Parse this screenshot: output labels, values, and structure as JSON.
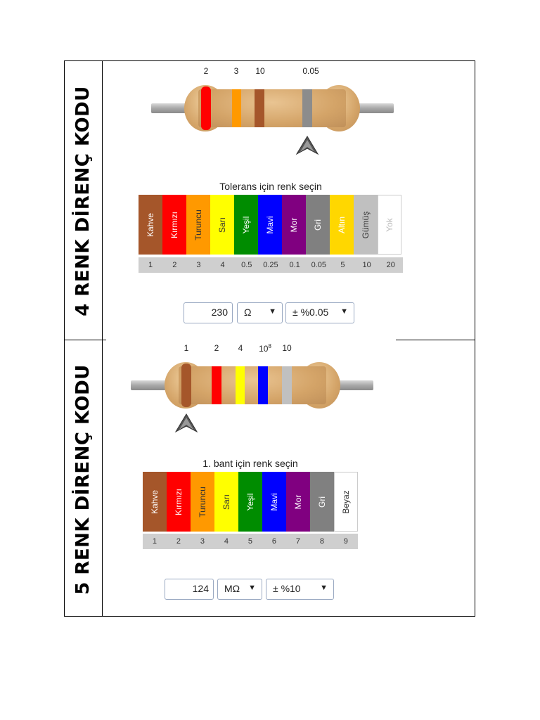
{
  "section4": {
    "title": "4 RENK DİRENÇ KODU",
    "band_labels": [
      "2",
      "3",
      "10",
      "0.05"
    ],
    "band_colors": [
      "#ff0000",
      "#ff9900",
      "#a5562a",
      "#8c8c8c"
    ],
    "picker_title": "Tolerans için renk seçin",
    "swatches": [
      {
        "label": "Kahve",
        "color": "#a5562a",
        "text_color": "#ffffff",
        "value": "1"
      },
      {
        "label": "Kırmızı",
        "color": "#ff0000",
        "text_color": "#ffffff",
        "value": "2"
      },
      {
        "label": "Turuncu",
        "color": "#ff9900",
        "text_color": "#333333",
        "value": "3"
      },
      {
        "label": "Sarı",
        "color": "#ffff00",
        "text_color": "#333333",
        "value": "4"
      },
      {
        "label": "Yeşil",
        "color": "#008c00",
        "text_color": "#ffffff",
        "value": "0.5"
      },
      {
        "label": "Mavi",
        "color": "#0000ff",
        "text_color": "#ffffff",
        "value": "0.25"
      },
      {
        "label": "Mor",
        "color": "#800080",
        "text_color": "#ffffff",
        "value": "0.1"
      },
      {
        "label": "Gri",
        "color": "#808080",
        "text_color": "#ffffff",
        "value": "0.05"
      },
      {
        "label": "Altın",
        "color": "#ffd700",
        "text_color": "#ffffff",
        "value": "5"
      },
      {
        "label": "Gümüş",
        "color": "#c0c0c0",
        "text_color": "#333333",
        "value": "10"
      },
      {
        "label": "Yok",
        "color": "#ffffff",
        "text_color": "#bbbbbb",
        "value": "20"
      }
    ],
    "resistance_value": "230",
    "unit": "Ω",
    "tolerance": "± %0.05"
  },
  "section5": {
    "title": "5 RENK DİRENÇ KODU",
    "band_labels": [
      "1",
      "2",
      "4",
      "10",
      "10"
    ],
    "band_label_exponent": "8",
    "band_colors": [
      "#a5562a",
      "#ff0000",
      "#ffff00",
      "#0000ff",
      "#c0c0c0"
    ],
    "picker_title": "1. bant için renk seçin",
    "swatches": [
      {
        "label": "Kahve",
        "color": "#a5562a",
        "text_color": "#ffffff",
        "value": "1"
      },
      {
        "label": "Kırmızı",
        "color": "#ff0000",
        "text_color": "#ffffff",
        "value": "2"
      },
      {
        "label": "Turuncu",
        "color": "#ff9900",
        "text_color": "#333333",
        "value": "3"
      },
      {
        "label": "Sarı",
        "color": "#ffff00",
        "text_color": "#333333",
        "value": "4"
      },
      {
        "label": "Yeşil",
        "color": "#008c00",
        "text_color": "#ffffff",
        "value": "5"
      },
      {
        "label": "Mavi",
        "color": "#0000ff",
        "text_color": "#ffffff",
        "value": "6"
      },
      {
        "label": "Mor",
        "color": "#800080",
        "text_color": "#ffffff",
        "value": "7"
      },
      {
        "label": "Gri",
        "color": "#808080",
        "text_color": "#ffffff",
        "value": "8"
      },
      {
        "label": "Beyaz",
        "color": "#ffffff",
        "text_color": "#333333",
        "value": "9"
      }
    ],
    "resistance_value": "124",
    "unit": "MΩ",
    "tolerance": "± %10"
  },
  "icons": {
    "pointer": "arrow-pointer-icon",
    "dropdown": "caret-down-icon"
  }
}
